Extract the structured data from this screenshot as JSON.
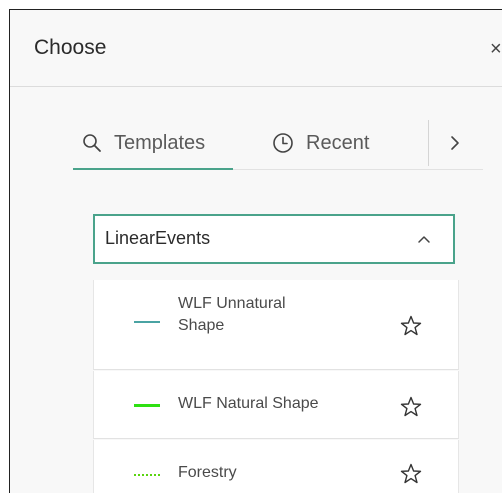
{
  "panel": {
    "title": "Choose",
    "close_glyph": "×"
  },
  "tabs": [
    {
      "label": "Templates",
      "icon": "search-icon",
      "active": true
    },
    {
      "label": "Recent",
      "icon": "clock-icon",
      "active": false
    }
  ],
  "tab_next_icon": "chevron-right-icon",
  "group": {
    "label": "LinearEvents",
    "expanded": true,
    "chevron_icon": "chevron-up-icon"
  },
  "items": [
    {
      "label": "WLF Unnatural Shape",
      "swatch_color": "#4aa3a3",
      "swatch_style": "solid",
      "favorite": false
    },
    {
      "label": "WLF Natural Shape",
      "swatch_color": "#2ee012",
      "swatch_style": "solid",
      "favorite": false
    },
    {
      "label": "Forestry",
      "swatch_color": "#5ad410",
      "swatch_style": "dotted",
      "favorite": false
    }
  ],
  "colors": {
    "accent": "#4aa38b"
  }
}
